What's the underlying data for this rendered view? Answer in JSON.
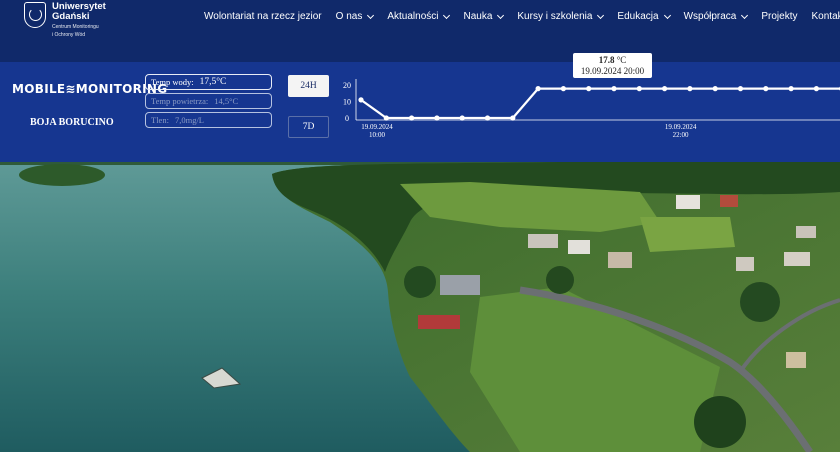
{
  "header": {
    "logo": {
      "name_line1": "Uniwersytet",
      "name_line2": "Gdański",
      "sub_line1": "Centrum Monitoringu",
      "sub_line2": "i Ochrony Wód"
    },
    "nav": [
      {
        "label": "Wolontariat na rzecz jezior",
        "dropdown": false
      },
      {
        "label": "O nas",
        "dropdown": true
      },
      {
        "label": "Aktualności",
        "dropdown": true
      },
      {
        "label": "Nauka",
        "dropdown": true
      },
      {
        "label": "Kursy i szkolenia",
        "dropdown": true
      },
      {
        "label": "Edukacja",
        "dropdown": true
      },
      {
        "label": "Współpraca",
        "dropdown": true
      },
      {
        "label": "Projekty",
        "dropdown": false
      },
      {
        "label": "Kontakt",
        "dropdown": false
      }
    ]
  },
  "monitoring": {
    "brand": "MOBILE≋MONITORING",
    "station": "BOJA BORUCINO",
    "params": [
      {
        "label": "Temp wody:",
        "value": "17,5°C",
        "active": true
      },
      {
        "label": "Temp powietrza:",
        "value": "14,5°C",
        "active": false
      },
      {
        "label": "Tlen:",
        "value": "7,0mg/L",
        "active": false
      }
    ],
    "ranges": [
      {
        "label": "24H",
        "selected": true
      },
      {
        "label": "7D",
        "selected": false
      }
    ]
  },
  "chart_data": {
    "type": "line",
    "series": [
      {
        "values": [
          11,
          0,
          0,
          0,
          0,
          0,
          0,
          17.8,
          17.8,
          17.8,
          17.8,
          17.8,
          17.8,
          17.8,
          17.8,
          17.8,
          17.8,
          17.8,
          17.8,
          17.8
        ]
      }
    ],
    "y_ticks": [
      "20",
      "10",
      "0"
    ],
    "ylim": [
      0,
      20
    ],
    "x_ticks": [
      {
        "date": "19.09.2024",
        "time": "10:00"
      },
      {
        "date": "19.09.2024",
        "time": "22:00"
      }
    ],
    "tooltip": {
      "value": "17.8",
      "unit": "°C",
      "time": "19.09.2024 20:00"
    },
    "colors": {
      "line": "#ffffff",
      "axis": "#ffffff"
    },
    "grid": false
  },
  "colors": {
    "nav_bg": "#10296a",
    "band_bg": "#163690",
    "water": "#3f8a86",
    "land": "#4f7f35"
  }
}
